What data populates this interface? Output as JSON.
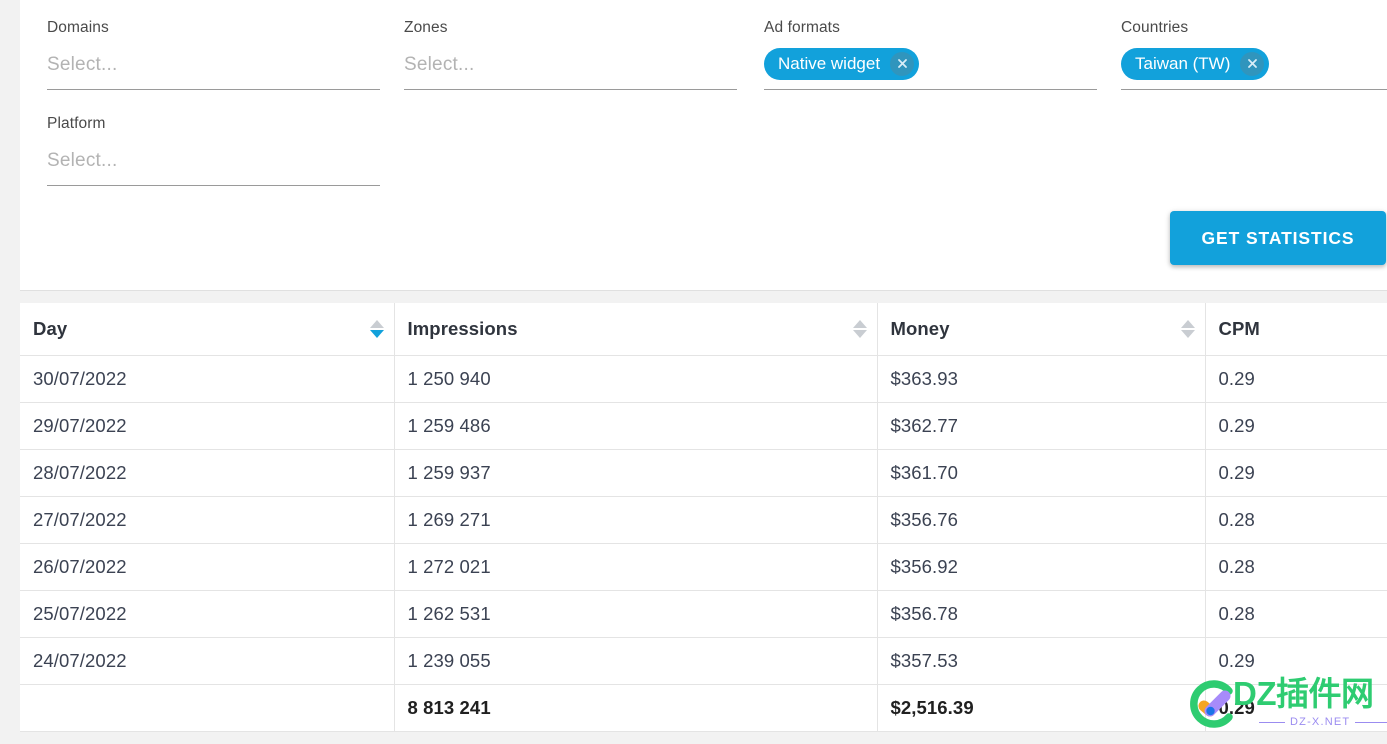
{
  "filters": {
    "domains": {
      "label": "Domains",
      "placeholder": "Select...",
      "value": ""
    },
    "zones": {
      "label": "Zones",
      "placeholder": "Select...",
      "value": ""
    },
    "ad_formats": {
      "label": "Ad formats",
      "chips": [
        "Native widget"
      ]
    },
    "countries": {
      "label": "Countries",
      "chips": [
        "Taiwan (TW)"
      ]
    },
    "platform": {
      "label": "Platform",
      "placeholder": "Select...",
      "value": ""
    },
    "submit_label": "GET STATISTICS"
  },
  "table": {
    "columns": [
      {
        "label": "Day",
        "sortable": true,
        "sort": "desc"
      },
      {
        "label": "Impressions",
        "sortable": true,
        "sort": "none"
      },
      {
        "label": "Money",
        "sortable": true,
        "sort": "none"
      },
      {
        "label": "CPM",
        "sortable": false,
        "sort": "none"
      }
    ],
    "rows": [
      {
        "day": "30/07/2022",
        "impressions": "1 250 940",
        "money": "$363.93",
        "cpm": "0.29"
      },
      {
        "day": "29/07/2022",
        "impressions": "1 259 486",
        "money": "$362.77",
        "cpm": "0.29"
      },
      {
        "day": "28/07/2022",
        "impressions": "1 259 937",
        "money": "$361.70",
        "cpm": "0.29"
      },
      {
        "day": "27/07/2022",
        "impressions": "1 269 271",
        "money": "$356.76",
        "cpm": "0.28"
      },
      {
        "day": "26/07/2022",
        "impressions": "1 272 021",
        "money": "$356.92",
        "cpm": "0.28"
      },
      {
        "day": "25/07/2022",
        "impressions": "1 262 531",
        "money": "$356.78",
        "cpm": "0.28"
      },
      {
        "day": "24/07/2022",
        "impressions": "1 239 055",
        "money": "$357.53",
        "cpm": "0.29"
      }
    ],
    "total": {
      "day": "",
      "impressions": "8 813 241",
      "money": "$2,516.39",
      "cpm": "0.29"
    }
  },
  "watermark": {
    "title": "DZ插件网",
    "subtitle": "DZ-X.NET"
  },
  "colors": {
    "accent": "#12a1db",
    "chip_close": "#3095bd",
    "sort_inactive": "#c9cdd2",
    "watermark_green": "#2ecc71",
    "watermark_purple": "#9b8cf0",
    "watermark_orange": "#f5a623",
    "watermark_blue": "#1a73e8"
  }
}
